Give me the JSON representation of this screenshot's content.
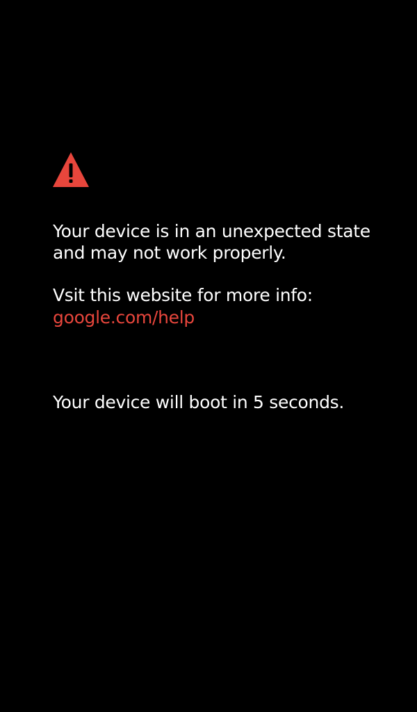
{
  "colors": {
    "background": "#000000",
    "text": "#ffffff",
    "accent": "#e8463c"
  },
  "warning": {
    "icon": "warning-triangle-icon",
    "glyph": "!"
  },
  "messages": {
    "state_line1": "Your device is in an unexpected state",
    "state_line2": "and may not work properly.",
    "visit": "Vsit this website for more info:",
    "link": "google.com/help",
    "boot": "Your device will boot in 5 seconds."
  }
}
